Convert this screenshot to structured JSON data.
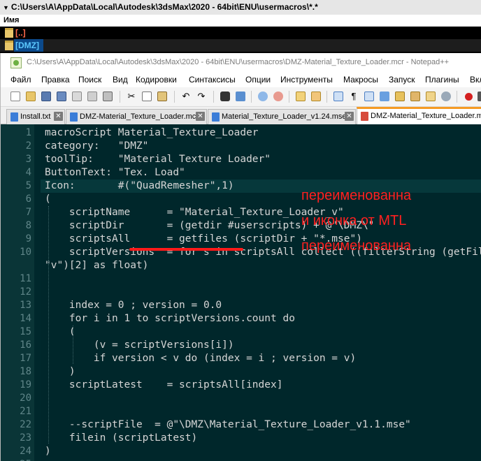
{
  "far": {
    "path": "C:\\Users\\A\\AppData\\Local\\Autodesk\\3dsMax\\2020 - 64bit\\ENU\\usermacros\\*.*",
    "column_header": "Имя",
    "rows": [
      "[..]",
      "[DMZ]"
    ]
  },
  "npp": {
    "title": "C:\\Users\\A\\AppData\\Local\\Autodesk\\3dsMax\\2020 - 64bit\\ENU\\usermacros\\DMZ-Material_Texture_Loader.mcr - Notepad++",
    "menu": [
      "Файл",
      "Правка",
      "Поиск",
      "Вид",
      "Кодировки",
      "Синтаксисы",
      "Опции",
      "Инструменты",
      "Макросы",
      "Запуск",
      "Плагины",
      "Вкладки"
    ],
    "tabs": [
      {
        "label": "Install.txt",
        "icon": "file-blue-icon"
      },
      {
        "label": "DMZ-Material_Texture_Loader.mcr",
        "icon": "file-blue-icon"
      },
      {
        "label": "Material_Texture_Loader_v1.24.mse",
        "icon": "file-blue-icon"
      },
      {
        "label": "DMZ-Material_Texture_Loader.mcr",
        "icon": "file-red-icon",
        "active": true
      }
    ],
    "close_glyph": "✕"
  },
  "editor": {
    "lines": [
      {
        "n": "1",
        "text": "macroScript Material_Texture_Loader"
      },
      {
        "n": "2",
        "text": "category:   \"DMZ\""
      },
      {
        "n": "3",
        "text": "toolTip:    \"Material Texture Loader\""
      },
      {
        "n": "4",
        "text": "ButtonText: \"Tex. Load\""
      },
      {
        "n": "5",
        "text": "Icon:       #(\"QuadRemesher\",1)"
      },
      {
        "n": "6",
        "text": "("
      },
      {
        "n": "7",
        "text": "    scriptName      = \"Material_Texture_Loader_v\""
      },
      {
        "n": "8",
        "text": "    scriptDir       = (getdir #userscripts) + @\"\\DMZ\\\""
      },
      {
        "n": "9",
        "text": "    scriptsAll      = getfiles (scriptDir + \"*.mse\")"
      },
      {
        "n": "10",
        "text": "    scriptVersions  = for s in scriptsAll collect ((filterString (getFilenameFile s)"
      },
      {
        "n": "",
        "text": "\"v\")[2] as float)"
      },
      {
        "n": "11",
        "text": ""
      },
      {
        "n": "12",
        "text": ""
      },
      {
        "n": "13",
        "text": "    index = 0 ; version = 0.0"
      },
      {
        "n": "14",
        "text": "    for i in 1 to scriptVersions.count do"
      },
      {
        "n": "15",
        "text": "    ("
      },
      {
        "n": "16",
        "text": "        (v = scriptVersions[i])"
      },
      {
        "n": "17",
        "text": "        if version < v do (index = i ; version = v)"
      },
      {
        "n": "18",
        "text": "    )"
      },
      {
        "n": "19",
        "text": "    scriptLatest    = scriptsAll[index]"
      },
      {
        "n": "20",
        "text": ""
      },
      {
        "n": "21",
        "text": ""
      },
      {
        "n": "22",
        "text": "    --scriptFile  = @\"\\DMZ\\Material_Texture_Loader_v1.1.mse\""
      },
      {
        "n": "23",
        "text": "    filein (scriptLatest)"
      },
      {
        "n": "24",
        "text": ")"
      },
      {
        "n": "25",
        "text": ""
      }
    ],
    "current_line": "5"
  },
  "annotation": {
    "lines": [
      "переименованна",
      "и иконка от MTL",
      "переименованна"
    ],
    "color": "#ff2020"
  }
}
